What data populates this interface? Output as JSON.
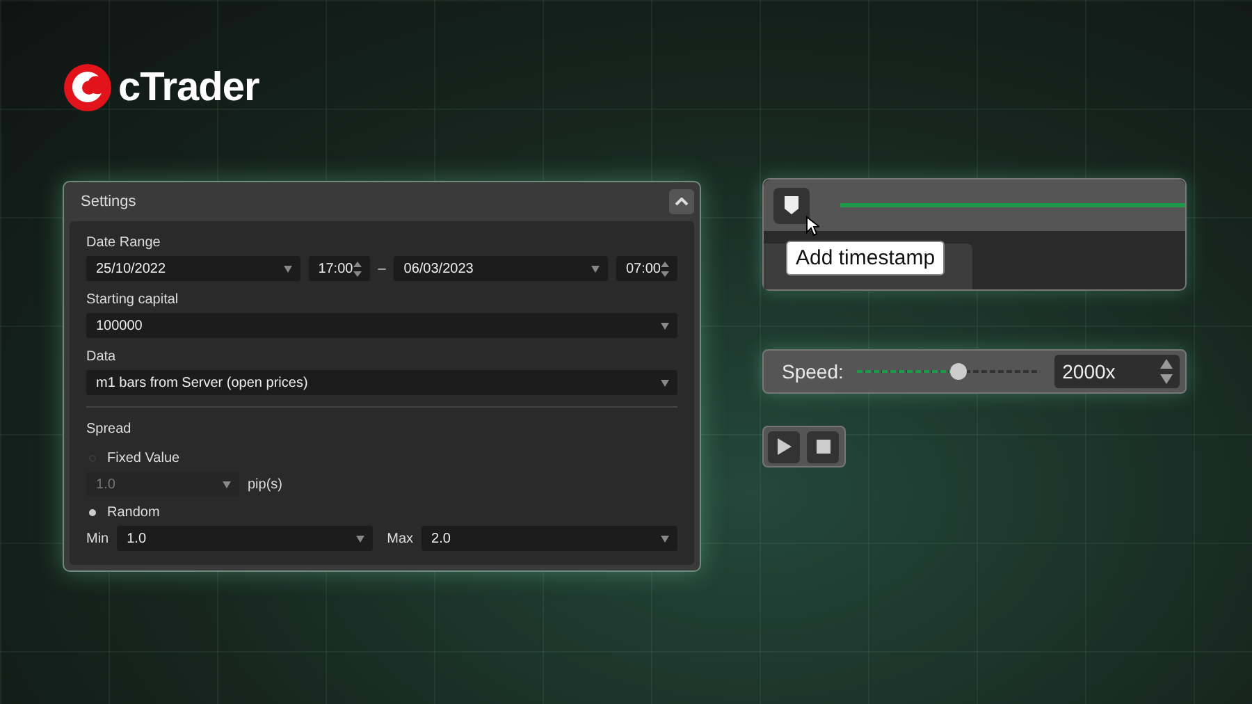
{
  "logo": {
    "text": "cTrader"
  },
  "settings": {
    "title": "Settings",
    "expanded": true,
    "date_range": {
      "label": "Date Range",
      "start_date": "25/10/2022",
      "start_time": "17:00",
      "separator": "–",
      "end_date": "06/03/2023",
      "end_time": "07:00"
    },
    "starting_capital": {
      "label": "Starting capital",
      "value": "100000"
    },
    "data": {
      "label": "Data",
      "value": "m1 bars from Server (open prices)"
    },
    "spread": {
      "label": "Spread",
      "options": [
        {
          "label": "Fixed Value",
          "selected": false
        },
        {
          "label": "Random",
          "selected": true
        }
      ],
      "fixed": {
        "value": "1.0",
        "unit": "pip(s)",
        "disabled": true
      },
      "min": {
        "label": "Min",
        "value": "1.0"
      },
      "max": {
        "label": "Max",
        "value": "2.0"
      }
    }
  },
  "timeline": {
    "tooltip": "Add timestamp"
  },
  "speed": {
    "label": "Speed:",
    "level": 0.55,
    "value": "2000x"
  }
}
